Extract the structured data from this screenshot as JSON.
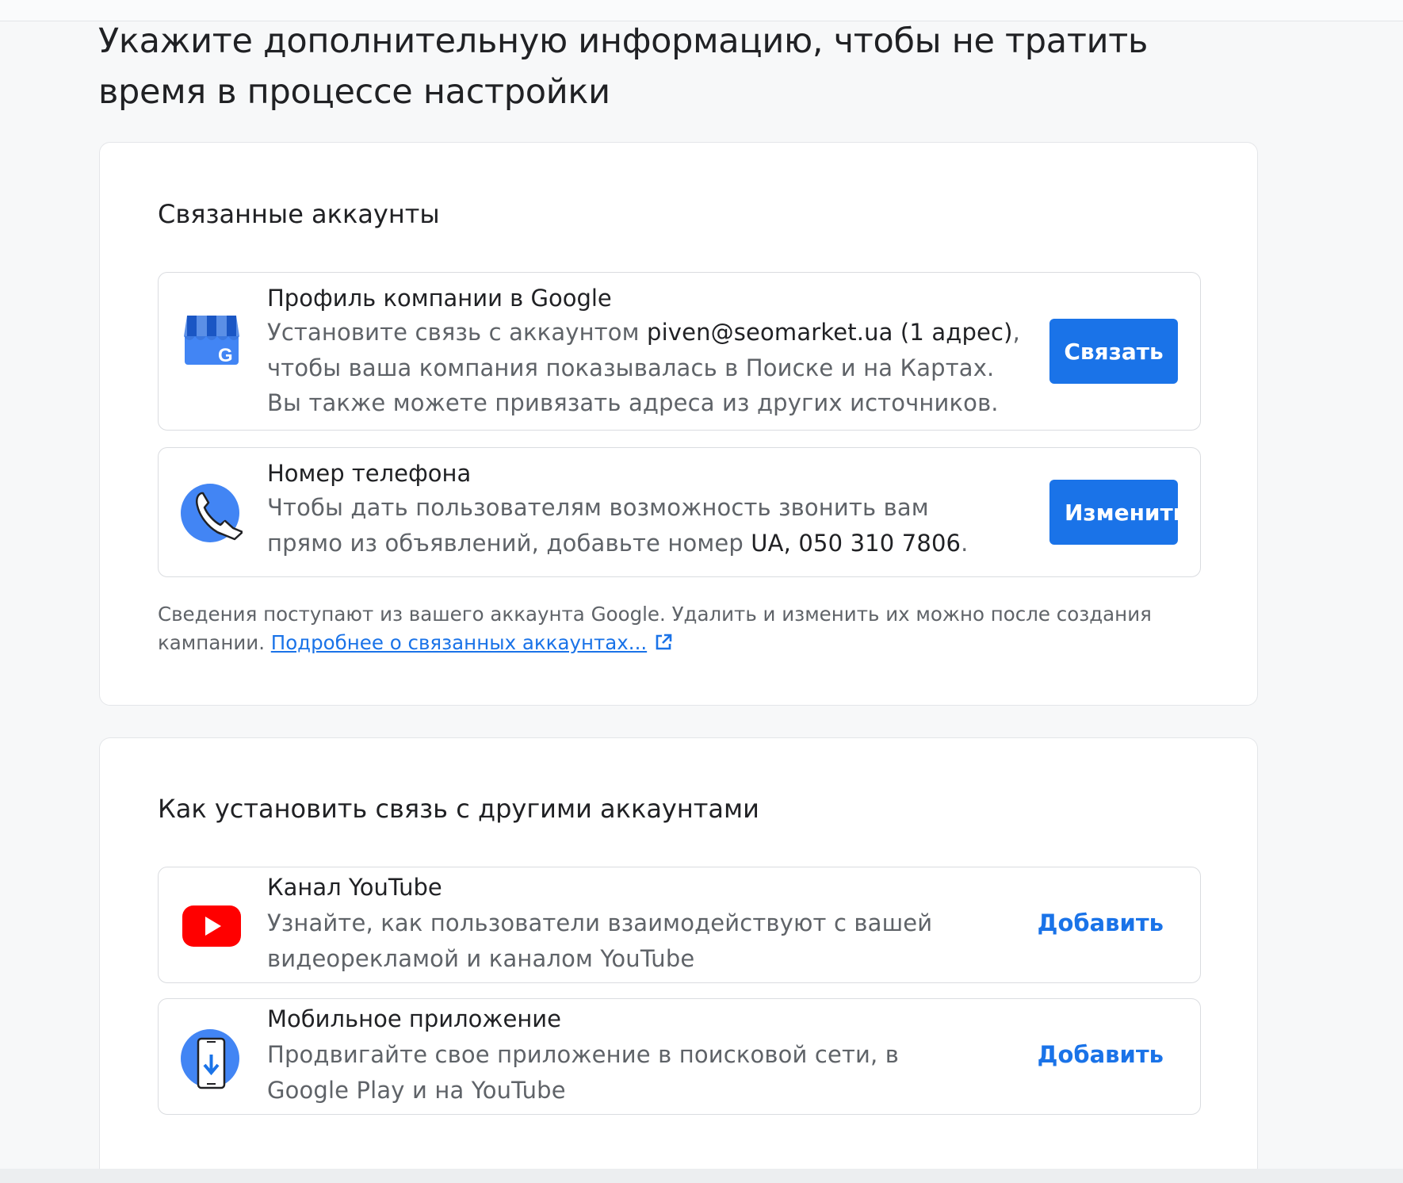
{
  "page": {
    "title": "Укажите дополнительную информацию, чтобы не тратить время в процессе настройки"
  },
  "linked_accounts": {
    "heading": "Связанные аккаунты",
    "business_profile": {
      "icon": "google-business-store-icon",
      "title": "Профиль компании в Google",
      "desc_prefix": "Установите связь с аккаунтом ",
      "account": "piven@seomarket.ua (1 адрес)",
      "desc_suffix": ", чтобы ваша компания показывалась в Поиске и на Картах. Вы также можете привязать адреса из других источников.",
      "button_label": "Связать"
    },
    "phone": {
      "icon": "phone-icon",
      "title": "Номер телефона",
      "desc_prefix": "Чтобы дать пользователям возможность звонить вам прямо из объявлений, добавьте номер ",
      "number": "UA, 050 310 7806",
      "desc_suffix": ".",
      "button_label": "Изменить"
    },
    "note_text": "Сведения поступают из вашего аккаунта Google. Удалить и изменить их можно после создания кампании. ",
    "note_link": "Подробнее о связанных аккаунтах..."
  },
  "other_accounts": {
    "heading": "Как установить связь с другими аккаунтами",
    "youtube": {
      "icon": "youtube-icon",
      "title": "Канал YouTube",
      "desc": "Узнайте, как пользователи взаимодействуют с вашей видеорекламой и каналом YouTube",
      "button_label": "Добавить"
    },
    "mobile_app": {
      "icon": "mobile-app-download-icon",
      "title": "Мобильное приложение",
      "desc": "Продвигайте свое приложение в поисковой сети, в Google Play и на YouTube",
      "button_label": "Добавить"
    }
  },
  "colors": {
    "accent": "#1a73e8",
    "youtube_red": "#ff0000",
    "icon_blue": "#4285f4"
  }
}
